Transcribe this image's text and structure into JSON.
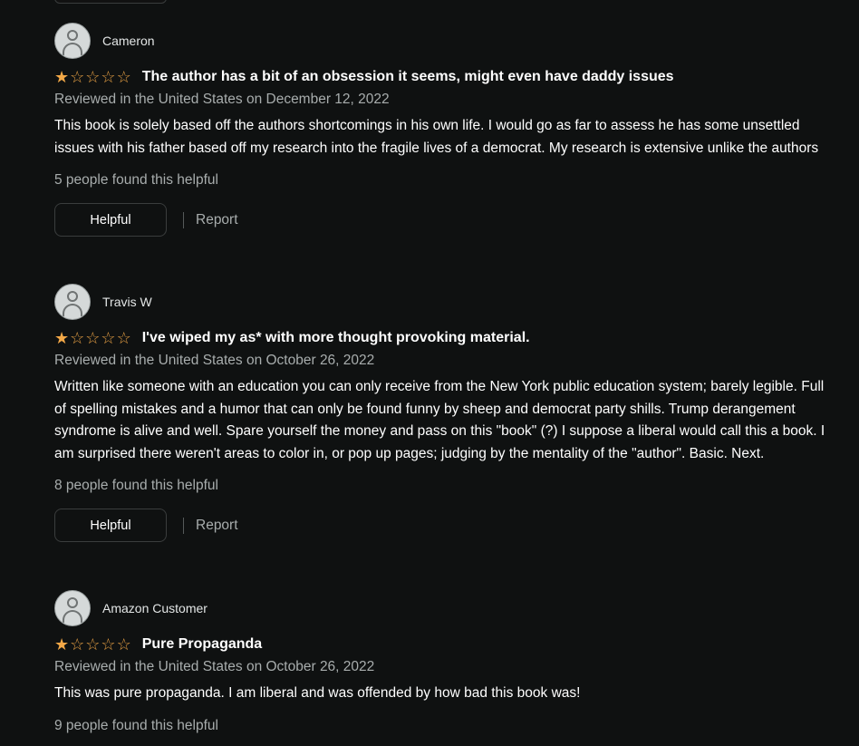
{
  "reviews": [
    {
      "name": "Cameron",
      "rating": 1,
      "title": "The author has a bit of an obsession it seems, might even have daddy issues",
      "date": "Reviewed in the United States on December 12, 2022",
      "body": "This book is solely based off the authors shortcomings in his own life. I would go as far to assess he has some unsettled issues with his father based off my research into the fragile lives of a democrat. My research is extensive unlike the authors",
      "helpful_count": "5 people found this helpful",
      "helpful_label": "Helpful",
      "report_label": "Report"
    },
    {
      "name": "Travis W",
      "rating": 1,
      "title": "I've wiped my as* with more thought provoking material.",
      "date": "Reviewed in the United States on October 26, 2022",
      "body": "Written like someone with an education you can only receive from the New York public education system; barely legible. Full of spelling mistakes and a humor that can only be found funny by sheep and democrat party shills. Trump derangement syndrome is alive and well. Spare yourself the money and pass on this \"book\" (?) I suppose a liberal would call this a book. I am surprised there weren't areas to color in, or pop up pages; judging by the mentality of the \"author\". Basic. Next.",
      "helpful_count": "8 people found this helpful",
      "helpful_label": "Helpful",
      "report_label": "Report"
    },
    {
      "name": "Amazon Customer",
      "rating": 1,
      "title": "Pure Propaganda",
      "date": "Reviewed in the United States on October 26, 2022",
      "body": "This was pure propaganda. I am liberal and was offended by how bad this book was!",
      "helpful_count": "9 people found this helpful"
    }
  ],
  "colors": {
    "background": "#0f1111",
    "star": "#f3a847",
    "muted_text": "#a8adad"
  },
  "icons": {
    "avatar": "user-avatar-icon",
    "star_filled": "star-filled-icon",
    "star_empty": "star-empty-icon"
  }
}
